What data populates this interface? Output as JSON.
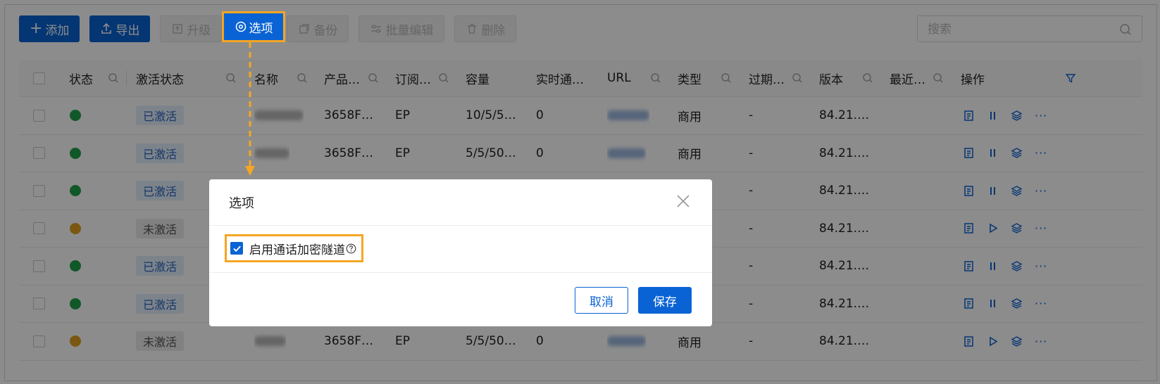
{
  "toolbar": {
    "add": "添加",
    "export": "导出",
    "upgrade": "升级",
    "options": "选项",
    "backup": "备份",
    "batch_edit": "批量编辑",
    "delete": "删除"
  },
  "search": {
    "placeholder": "搜索"
  },
  "table": {
    "headers": {
      "status": "状态",
      "activation": "激活状态",
      "name": "名称",
      "product": "产品…",
      "subscription": "订阅…",
      "capacity": "容量",
      "realtime": "实时通…",
      "url": "URL",
      "type": "类型",
      "expire": "过期…",
      "version": "版本",
      "recent": "最近…",
      "actions": "操作"
    },
    "rows": [
      {
        "status": "ok",
        "activation": "已激活",
        "product": "3658F…",
        "subscription": "EP",
        "capacity": "10/5/5…",
        "realtime": "0",
        "type": "商用",
        "expire": "-",
        "version": "84.21.…",
        "play": false
      },
      {
        "status": "ok",
        "activation": "已激活",
        "product": "3658F…",
        "subscription": "EP",
        "capacity": "5/5/50…",
        "realtime": "0",
        "type": "商用",
        "expire": "-",
        "version": "84.21.…",
        "play": false
      },
      {
        "status": "ok",
        "activation": "已激活",
        "product": "",
        "subscription": "",
        "capacity": "",
        "realtime": "",
        "type": "",
        "expire": "-",
        "version": "84.21.…",
        "play": false
      },
      {
        "status": "warn",
        "activation": "未激活",
        "product": "",
        "subscription": "",
        "capacity": "",
        "realtime": "",
        "type": "",
        "expire": "-",
        "version": "84.21.…",
        "play": true
      },
      {
        "status": "ok",
        "activation": "已激活",
        "product": "",
        "subscription": "",
        "capacity": "",
        "realtime": "",
        "type": "",
        "expire": "-",
        "version": "84.21.…",
        "play": false
      },
      {
        "status": "ok",
        "activation": "已激活",
        "product": "",
        "subscription": "",
        "capacity": "",
        "realtime": "",
        "type": "",
        "expire": "-",
        "version": "84.21.…",
        "play": false
      },
      {
        "status": "warn",
        "activation": "未激活",
        "product": "3658F…",
        "subscription": "EP",
        "capacity": "5/5/50…",
        "realtime": "0",
        "type": "商用",
        "expire": "-",
        "version": "84.21.…",
        "play": true
      }
    ]
  },
  "modal": {
    "title": "选项",
    "checkbox_label": "启用通话加密隧道",
    "checked": true,
    "cancel": "取消",
    "save": "保存"
  },
  "colors": {
    "primary": "#0a63d4",
    "highlight": "#f5a623",
    "ok": "#1fa04a",
    "warn": "#e0a020"
  }
}
